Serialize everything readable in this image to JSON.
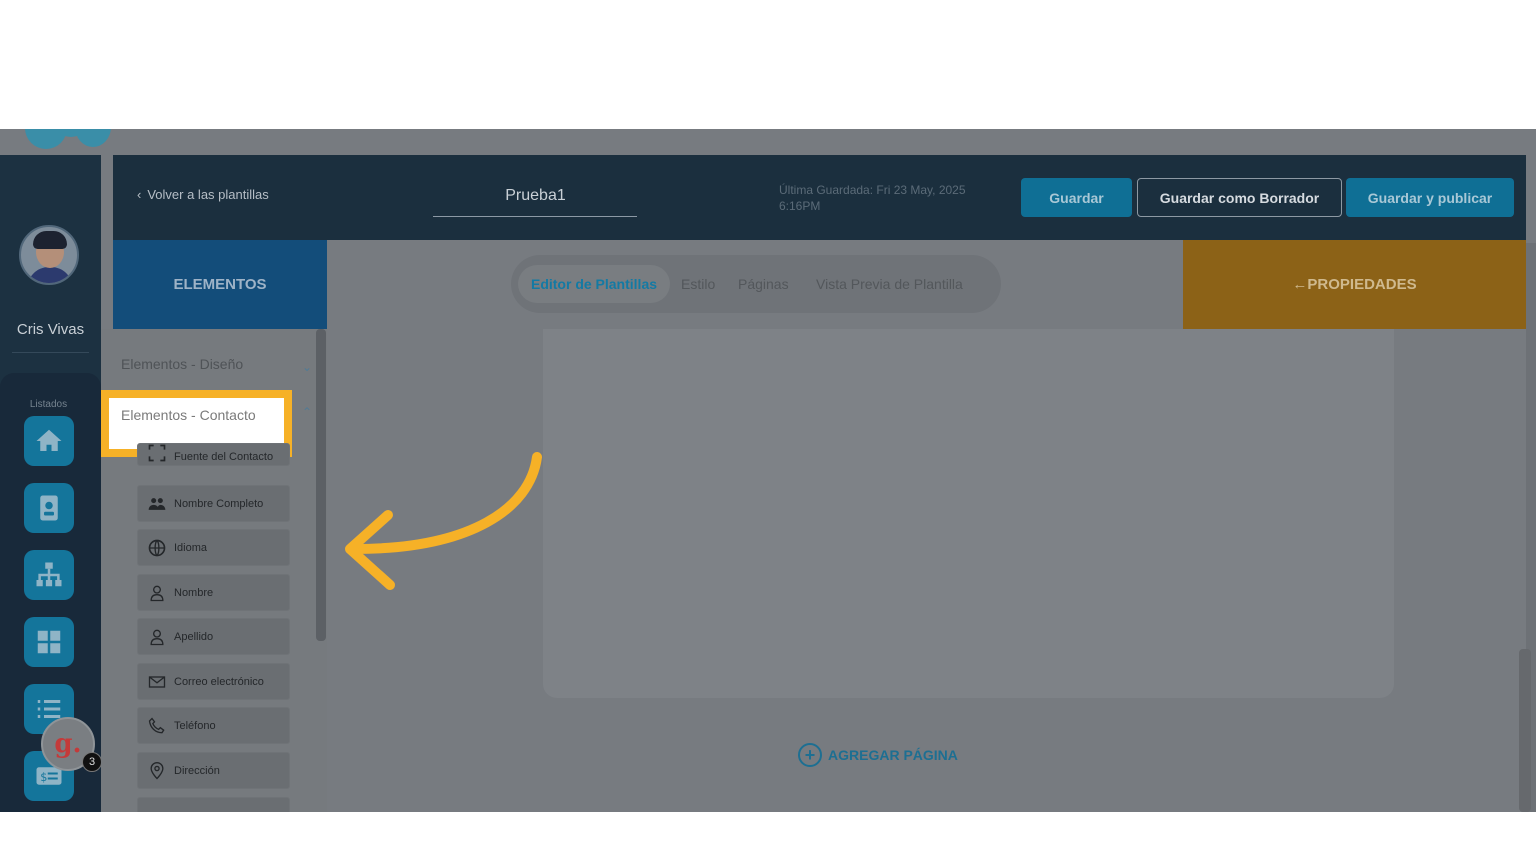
{
  "user": {
    "name": "Cris Vivas"
  },
  "rail": {
    "section_label": "Listados",
    "notification_count": "3",
    "badge_letter": "g."
  },
  "header": {
    "back_label": "Volver a las plantillas",
    "title": "Prueba1",
    "last_saved": "Última Guardada: Fri 23 May, 2025 6:16PM",
    "save_label": "Guardar",
    "draft_label": "Guardar como Borrador",
    "publish_label": "Guardar y publicar"
  },
  "elements_tab": {
    "label": "ELEMENTOS"
  },
  "sections": {
    "design": "Elementos - Diseño",
    "contact": "Elementos - Contacto"
  },
  "contact_items": [
    {
      "label": "Fuente del Contacto",
      "icon": "scan-icon"
    },
    {
      "label": "Nombre Completo",
      "icon": "users-icon"
    },
    {
      "label": "Idioma",
      "icon": "globe-icon"
    },
    {
      "label": "Nombre",
      "icon": "person-icon"
    },
    {
      "label": "Apellido",
      "icon": "person-icon"
    },
    {
      "label": "Correo electrónico",
      "icon": "envelope-icon"
    },
    {
      "label": "Teléfono",
      "icon": "phone-icon"
    },
    {
      "label": "Dirección",
      "icon": "location-pin-icon"
    }
  ],
  "editor_tabs": [
    "Editor de Plantillas",
    "Estilo",
    "Páginas",
    "Vista Previa de Plantilla"
  ],
  "add_page_label": "AGREGAR PÁGINA",
  "properties": {
    "label": "PROPIEDADES"
  },
  "colors": {
    "highlight": "#f6b127",
    "accent": "#137aa4",
    "properties_bg": "#8c6217"
  }
}
